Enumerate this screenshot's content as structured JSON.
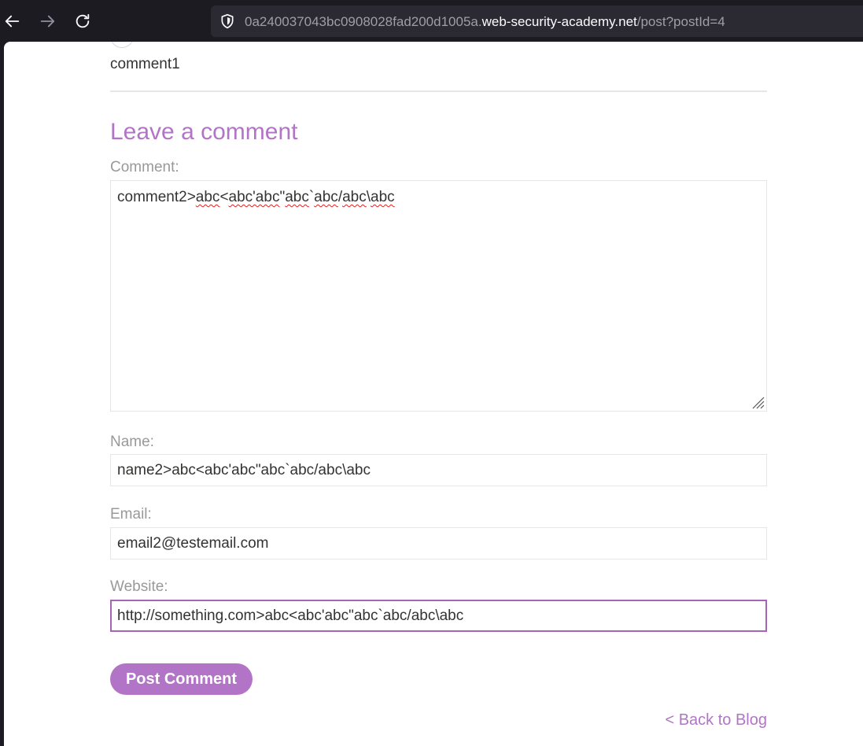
{
  "browser": {
    "back_icon": "arrow-left-icon",
    "forward_icon": "arrow-right-icon",
    "reload_icon": "reload-icon",
    "security_icon": "shield-icon",
    "url_prefix": "0a240037043bc0908028fad200d1005a.",
    "url_host": "web-security-academy.net",
    "url_path": "/post?postId=4"
  },
  "previous_comment": {
    "text": "comment1"
  },
  "form": {
    "title": "Leave a comment",
    "comment_label": "Comment:",
    "comment_value_parts": [
      "comment2>",
      "abc",
      "<",
      "abc'abc",
      "\"",
      "abc",
      "`",
      "abc",
      "/",
      "abc",
      "\\",
      "abc"
    ],
    "name_label": "Name:",
    "name_value": "name2>abc<abc'abc\"abc`abc/abc\\abc",
    "email_label": "Email:",
    "email_value": "email2@testemail.com",
    "website_label": "Website:",
    "website_value": "http://something.com>abc<abc'abc\"abc`abc/abc\\abc",
    "submit_label": "Post Comment"
  },
  "footer": {
    "back_link": "< Back to Blog"
  },
  "colors": {
    "accent": "#b274c6",
    "label": "#999999",
    "text": "#333332",
    "browser_bg": "#1c1b22",
    "urlbar_bg": "#2b2a33"
  }
}
